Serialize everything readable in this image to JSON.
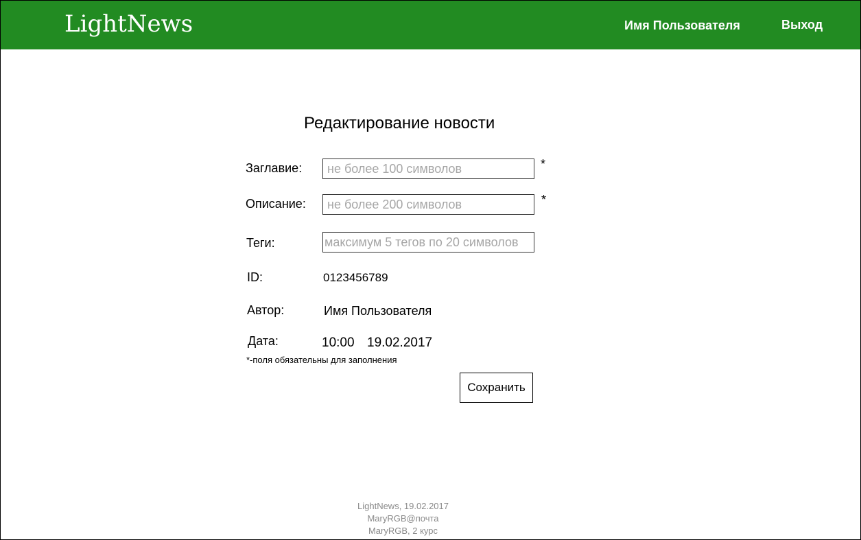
{
  "header": {
    "logo": "LightNews",
    "user_name": "Имя Пользователя",
    "logout": "Выход"
  },
  "form": {
    "title": "Редактирование новости",
    "fields": {
      "headline": {
        "label": "Заглавие:",
        "placeholder": "не более 100 символов",
        "value": "",
        "required_mark": "*"
      },
      "description": {
        "label": "Описание:",
        "placeholder": "не более 200 символов",
        "value": "",
        "required_mark": "*"
      },
      "tags": {
        "label": "Теги:",
        "placeholder": "максимум 5 тегов по 20 символов",
        "value": ""
      }
    },
    "id": {
      "label": "ID:",
      "value": "0123456789"
    },
    "author": {
      "label": "Автор:",
      "value": "Имя Пользователя"
    },
    "date": {
      "label": "Дата:",
      "time": "10:00",
      "date": "19.02.2017"
    },
    "required_note": "*-поля обязательны для заполнения",
    "save_label": "Сохранить"
  },
  "footer": {
    "line1": "LightNews, 19.02.2017",
    "line2": "MaryRGB@почта",
    "line3": "MaryRGB, 2 курс"
  },
  "colors": {
    "header_bg": "#228b22",
    "header_text": "#ffffff",
    "placeholder": "#a6a6a6",
    "footer_text": "#8a8a8a"
  }
}
